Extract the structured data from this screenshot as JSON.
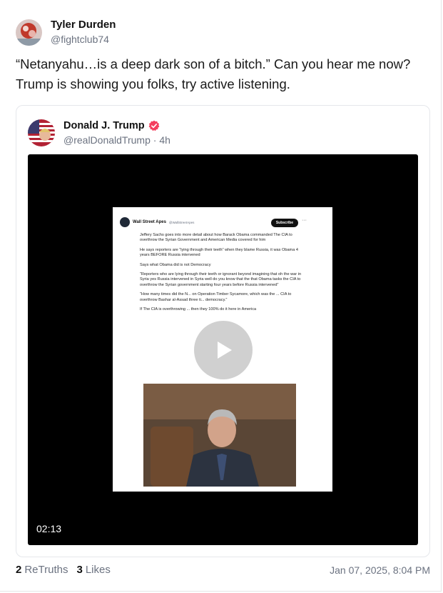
{
  "post": {
    "author": {
      "display_name": "Tyler Durden",
      "handle": "@fightclub74"
    },
    "text_line1": "“Netanyahu…is a deep dark son of a bitch.”  Can you hear me now?",
    "text_line2": "Trump is showing you folks, try active listening."
  },
  "quoted": {
    "author": {
      "display_name": "Donald J. Trump",
      "handle": "@realDonaldTrump",
      "time": "4h"
    },
    "meta_separator": "·",
    "verified_color": "#f43f5e",
    "video": {
      "duration": "02:13",
      "thumbnail": {
        "account_name": "Wall Street Apes",
        "account_handle": "@WallStreetApes",
        "subscribe_label": "Subscribe",
        "more": "···",
        "paragraphs": [
          "Jeffery Sachs goes into more detail about how Barack Obama commanded The CIA to overthrow the Syrian Government and American Media covered for him",
          "He says reporters are “lying through their teeth” when they blame Russia, it was Obama 4 years BEFORE Russia intervened",
          "Says what Obama did is not Democracy",
          "“Reporters who are lying through their teeth or ignorant beyond imagining that oh the war in Syria yes Russia intervened in Syria well do you know that the that Obama tasks the CIA to overthrow the Syrian government starting four years before Russia intervened”",
          "“How many times did the N... on Operation Timber Sycamore, which was the ... CIA to overthrow Bashar al-Assad three ti... democracy.”",
          "If The CIA is overthrowing ... then they 100% do it here in America"
        ]
      }
    }
  },
  "footer": {
    "retruths_count": "2",
    "retruths_label": "ReTruths",
    "likes_count": "3",
    "likes_label": "Likes",
    "timestamp": "Jan 07, 2025, 8:04 PM"
  }
}
